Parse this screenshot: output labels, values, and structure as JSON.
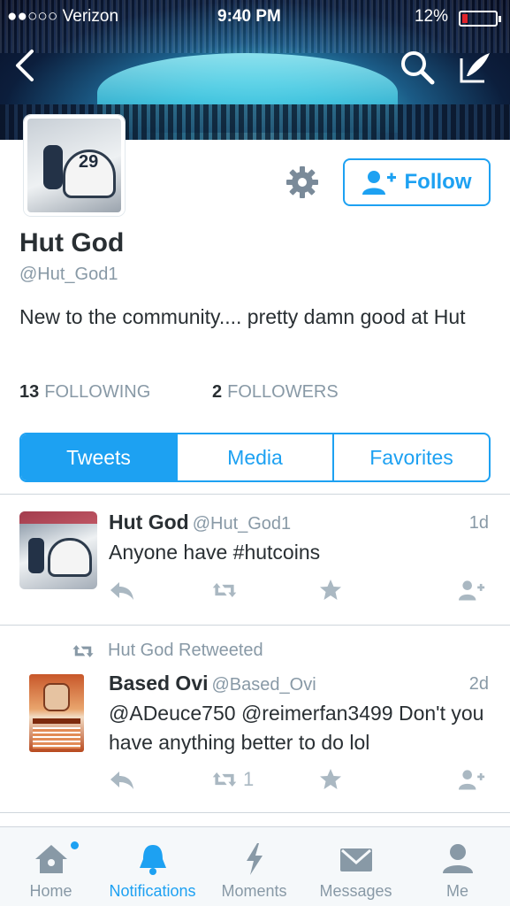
{
  "status_bar": {
    "carrier": "●●○○○ Verizon",
    "time": "9:40 PM",
    "battery": "12%"
  },
  "profile": {
    "name": "Hut God",
    "handle": "@Hut_God1",
    "bio": "New to the community.... pretty damn good at Hut",
    "following_count": "13",
    "following_label": "FOLLOWING",
    "followers_count": "2",
    "followers_label": "FOLLOWERS",
    "follow_label": "Follow"
  },
  "profile_tabs": [
    {
      "label": "Tweets",
      "active": true
    },
    {
      "label": "Media",
      "active": false
    },
    {
      "label": "Favorites",
      "active": false
    }
  ],
  "tweets": [
    {
      "name": "Hut God",
      "handle": "@Hut_God1",
      "time": "1d",
      "text": "Anyone have #hutcoins",
      "retweet_count": ""
    },
    {
      "retweeted_by": "Hut God Retweeted",
      "name": "Based Ovi",
      "handle": "@Based_Ovi",
      "time": "2d",
      "text": "@ADeuce750 @reimerfan3499 Don't you have anything better to do lol",
      "retweet_count": "1"
    }
  ],
  "tab_bar": [
    {
      "label": "Home",
      "icon": "home-icon"
    },
    {
      "label": "Notifications",
      "icon": "bell-icon"
    },
    {
      "label": "Moments",
      "icon": "lightning-icon"
    },
    {
      "label": "Messages",
      "icon": "envelope-icon"
    },
    {
      "label": "Me",
      "icon": "person-icon"
    }
  ],
  "colors": {
    "accent": "#1da1f2",
    "muted": "#8899a6",
    "text": "#292f33",
    "battery_low": "#e0242c"
  }
}
